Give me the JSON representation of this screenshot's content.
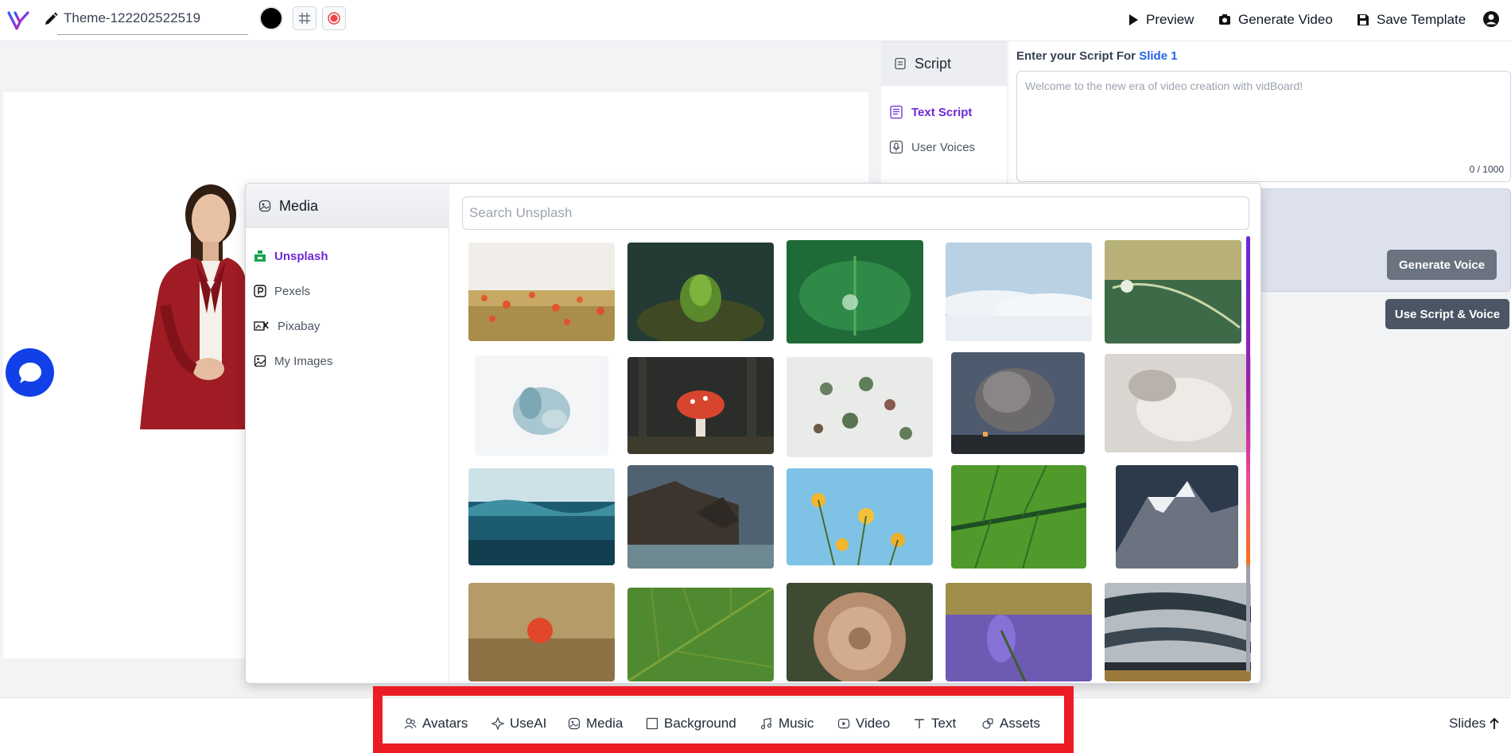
{
  "header": {
    "theme_name": "Theme-122202522519",
    "preview_label": "Preview",
    "generate_video_label": "Generate Video",
    "save_template_label": "Save Template"
  },
  "script_panel": {
    "title": "Script",
    "nav": [
      "Text Script",
      "User Voices"
    ],
    "prompt_prefix": "Enter your Script For",
    "slide_ref": "Slide 1",
    "placeholder": "Welcome to the new era of video creation with vidBoard!",
    "char_count": "0 / 1000",
    "generate_voice_label": "Generate Voice",
    "use_script_label": "Use Script & Voice"
  },
  "media_panel": {
    "title": "Media",
    "sources": [
      "Unsplash",
      "Pexels",
      "Pixabay",
      "My Images"
    ],
    "active_source": "Unsplash",
    "search_placeholder": "Search Unsplash"
  },
  "images": [
    {
      "desc": "poppy-field"
    },
    {
      "desc": "moss-sprout"
    },
    {
      "desc": "water-drop-leaf"
    },
    {
      "desc": "clouds-sky"
    },
    {
      "desc": "dew-on-grass"
    },
    {
      "desc": "pale-flowers"
    },
    {
      "desc": "red-mushroom"
    },
    {
      "desc": "succulents"
    },
    {
      "desc": "volcano-smoke"
    },
    {
      "desc": "frost-plant"
    },
    {
      "desc": "ocean-wave"
    },
    {
      "desc": "sea-arch"
    },
    {
      "desc": "yellow-flowers"
    },
    {
      "desc": "green-leaf-vein"
    },
    {
      "desc": "snowy-mountain"
    },
    {
      "desc": "red-flower-field"
    },
    {
      "desc": "green-leaf"
    },
    {
      "desc": "dandelion"
    },
    {
      "desc": "lavender"
    },
    {
      "desc": "glacier-stripes"
    }
  ],
  "bottom_tabs": [
    {
      "label": "Avatars",
      "icon": "avatars-icon"
    },
    {
      "label": "UseAI",
      "icon": "useai-icon"
    },
    {
      "label": "Media",
      "icon": "media-icon"
    },
    {
      "label": "Background",
      "icon": "background-icon"
    },
    {
      "label": "Music",
      "icon": "music-icon"
    },
    {
      "label": "Video",
      "icon": "video-icon"
    },
    {
      "label": "Text",
      "icon": "text-icon"
    },
    {
      "label": "Assets",
      "icon": "assets-icon"
    }
  ],
  "slides_label": "Slides",
  "colors": {
    "accent": "#6d28d9",
    "highlight": "#ec1c24",
    "chat": "#1140e8",
    "link": "#2563eb"
  }
}
